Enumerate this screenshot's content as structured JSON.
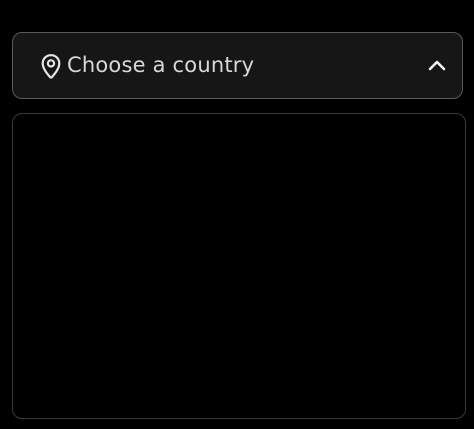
{
  "country_select": {
    "placeholder": "Choose a country",
    "expanded": true,
    "icon_left": "map-pin-icon",
    "icon_right": "chevron-up-icon",
    "options": []
  },
  "colors": {
    "background": "#000000",
    "trigger_background": "#161616",
    "trigger_border": "#5a5a5a",
    "panel_border": "#3a3a3a",
    "text": "#d8d8d8"
  }
}
